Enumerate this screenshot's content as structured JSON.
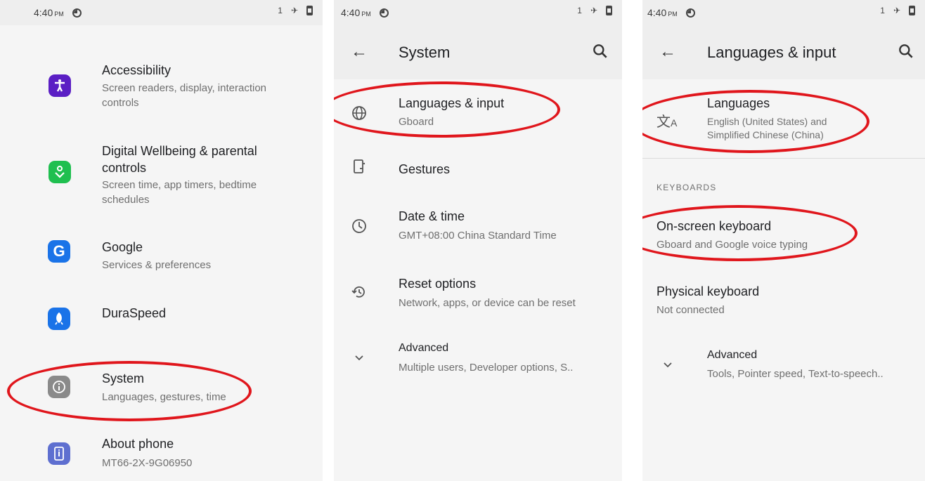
{
  "status": {
    "time": "4:40",
    "ampm": "PM",
    "sim": "1"
  },
  "panel1": {
    "items": [
      {
        "title": "Accessibility",
        "subtitle1": "Screen readers, display, interaction",
        "subtitle2": "controls"
      },
      {
        "title1": "Digital Wellbeing & parental",
        "title2": "controls",
        "subtitle1": "Screen time, app timers, bedtime",
        "subtitle2": "schedules"
      },
      {
        "title": "Google",
        "subtitle": "Services & preferences"
      },
      {
        "title": "DuraSpeed"
      },
      {
        "title": "System",
        "subtitle": "Languages, gestures, time"
      },
      {
        "title": "About phone",
        "subtitle": "MT66-2X-9G06950"
      }
    ],
    "icon_colors": {
      "accessibility": "#5b1fc4",
      "wellbeing": "#1fbf4f",
      "google": "#1a73e8",
      "duraspeed": "#1a73e8",
      "system": "#8a8a8a",
      "about": "#5e6fd0"
    }
  },
  "panel2": {
    "title": "System",
    "items": [
      {
        "title": "Languages & input",
        "subtitle": "Gboard"
      },
      {
        "title": "Gestures"
      },
      {
        "title": "Date & time",
        "subtitle": "GMT+08:00 China Standard Time"
      },
      {
        "title": "Reset options",
        "subtitle": "Network, apps, or device can be reset"
      },
      {
        "title": "Advanced",
        "subtitle": "Multiple users, Developer options, S.."
      }
    ]
  },
  "panel3": {
    "title": "Languages & input",
    "languages": {
      "title": "Languages",
      "subtitle1": "English (United States) and",
      "subtitle2": "Simplified Chinese (China)"
    },
    "section_header": "KEYBOARDS",
    "onscreen": {
      "title": "On-screen keyboard",
      "subtitle": "Gboard and Google voice typing"
    },
    "physical": {
      "title": "Physical keyboard",
      "subtitle": "Not connected"
    },
    "advanced": {
      "title": "Advanced",
      "subtitle": "Tools, Pointer speed, Text-to-speech.."
    }
  },
  "annotation_color": "#e0161c"
}
